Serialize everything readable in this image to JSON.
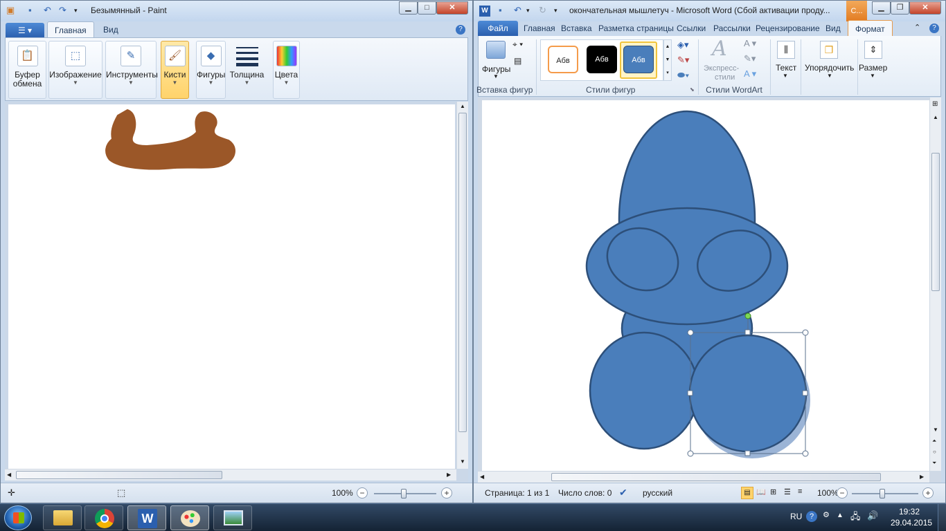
{
  "paint": {
    "title": "Безымянный - Paint",
    "tabs": [
      "Главная",
      "Вид"
    ],
    "groups": [
      {
        "label": "Буфер",
        "label2": "обмена",
        "icon": "clipboard-icon"
      },
      {
        "label": "Изображение",
        "icon": "image-select-icon"
      },
      {
        "label": "Инструменты",
        "icon": "tools-icon"
      },
      {
        "label": "Кисти",
        "icon": "brushes-icon"
      },
      {
        "label": "Фигуры",
        "icon": "shapes-icon"
      },
      {
        "label": "Толщина",
        "icon": "line-thickness-icon"
      },
      {
        "label": "Цвета",
        "icon": "colors-icon"
      }
    ],
    "status": {
      "zoom": "100%"
    },
    "colors": {
      "brush_stroke": "#9b5728",
      "active_group": "#ffd36b"
    }
  },
  "word": {
    "title": "окончательная мышлетуч - Microsoft Word (Сбой активации проду...",
    "context_tab_short": "С...",
    "tabs": [
      "Файл",
      "Главная",
      "Вставка",
      "Разметка страницы",
      "Ссылки",
      "Рассылки",
      "Рецензирование",
      "Вид",
      "Формат"
    ],
    "ribbon": {
      "insert_shapes": {
        "button": "Фигуры",
        "group_title": "Вставка фигур"
      },
      "shape_styles": {
        "samples": [
          "Абв",
          "Абв",
          "Абв"
        ],
        "group_title": "Стили фигур"
      },
      "wordart": {
        "button1": "Экспресс-",
        "button2": "стили",
        "group_title": "Стили WordArt"
      },
      "text": {
        "button": "Текст"
      },
      "arrange": {
        "button": "Упорядочить"
      },
      "size": {
        "button": "Размер"
      }
    },
    "status": {
      "page": "Страница: 1 из 1",
      "words": "Число слов: 0",
      "language": "русский",
      "zoom": "100%"
    },
    "colors": {
      "shape_fill": "#4a7ebb",
      "shape_stroke": "#2d4f79",
      "file_tab": "#2b5fae"
    }
  },
  "taskbar": {
    "items": [
      "explorer-icon",
      "chrome-icon",
      "word-icon",
      "paint-icon",
      "image-viewer-icon"
    ],
    "language": "RU",
    "time": "19:32",
    "date": "29.04.2015"
  }
}
